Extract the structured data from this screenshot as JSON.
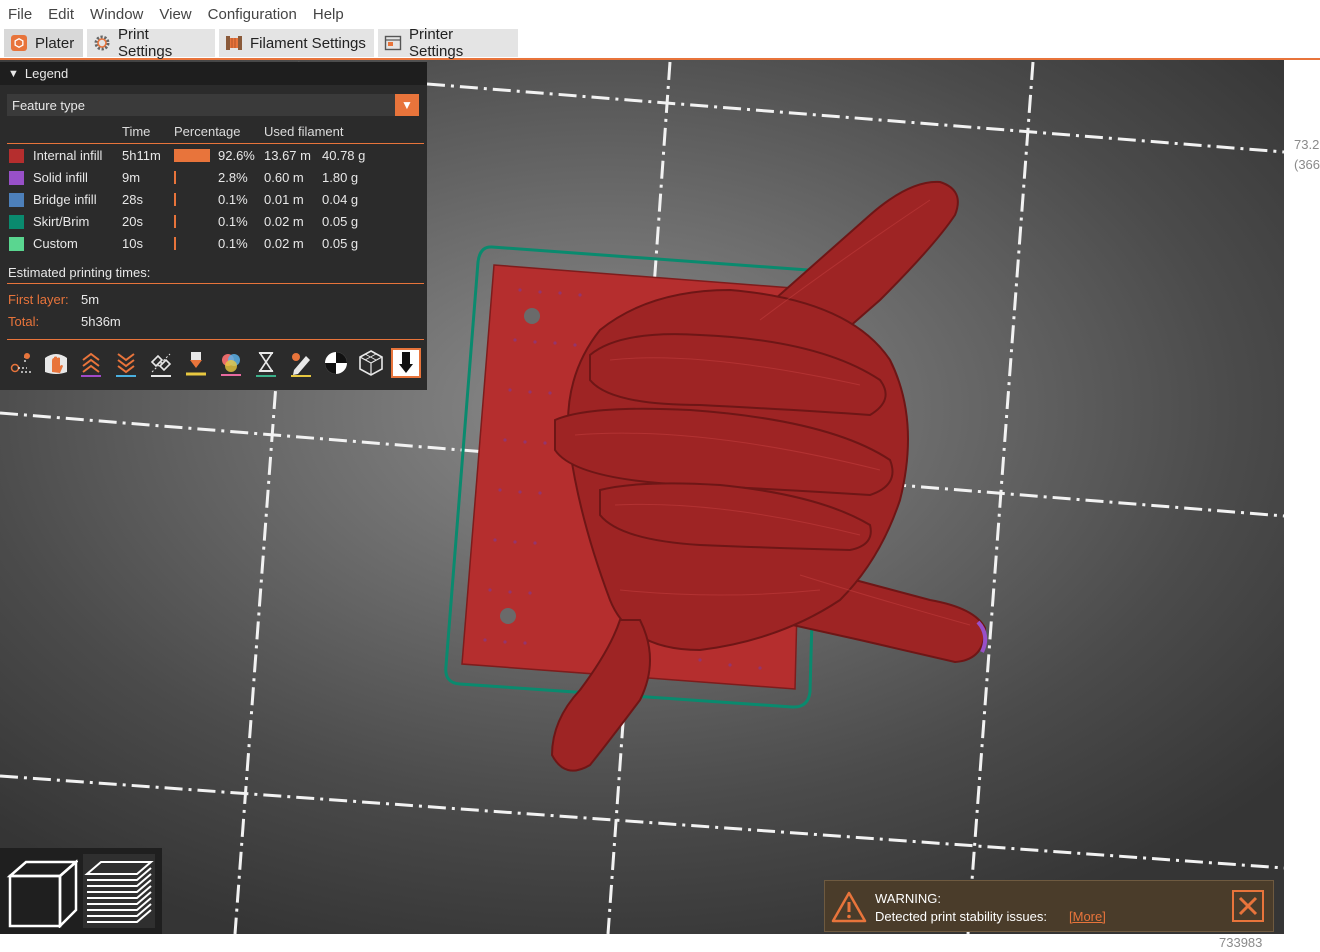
{
  "menu": [
    "File",
    "Edit",
    "Window",
    "View",
    "Configuration",
    "Help"
  ],
  "tabs": [
    {
      "label": "Plater",
      "icon": "plater-icon",
      "active": true
    },
    {
      "label": "Print Settings",
      "icon": "gear-icon"
    },
    {
      "label": "Filament Settings",
      "icon": "filament-spool-icon"
    },
    {
      "label": "Printer Settings",
      "icon": "printer-icon"
    }
  ],
  "legend": {
    "title": "Legend",
    "view_type": "Feature type",
    "columns": {
      "time": "Time",
      "percentage": "Percentage",
      "used_filament": "Used filament"
    },
    "rows": [
      {
        "name": "Internal infill",
        "color": "#b52e2e",
        "time": "5h11m",
        "percent_value": 92.6,
        "percent": "92.6%",
        "length": "13.67 m",
        "weight": "40.78 g"
      },
      {
        "name": "Solid infill",
        "color": "#9850c8",
        "time": "9m",
        "percent_value": 2.8,
        "percent": "2.8%",
        "length": "0.60 m",
        "weight": "1.80 g"
      },
      {
        "name": "Bridge infill",
        "color": "#4d80ba",
        "time": "28s",
        "percent_value": 0.1,
        "percent": "0.1%",
        "length": "0.01 m",
        "weight": "0.04 g"
      },
      {
        "name": "Skirt/Brim",
        "color": "#0a8a6e",
        "time": "20s",
        "percent_value": 0.1,
        "percent": "0.1%",
        "length": "0.02 m",
        "weight": "0.05 g"
      },
      {
        "name": "Custom",
        "color": "#5ad690",
        "time": "10s",
        "percent_value": 0.1,
        "percent": "0.1%",
        "length": "0.02 m",
        "weight": "0.05 g"
      }
    ],
    "estimated_label": "Estimated printing times:",
    "first_layer_label": "First layer:",
    "first_layer_value": "5m",
    "total_label": "Total:",
    "total_value": "5h36m",
    "toolbar_icons": [
      "travel-icon",
      "wipe-hand-icon",
      "retractions-icon",
      "deretractions-icon",
      "seams-icon",
      "tool-changes-icon",
      "color-changes-icon",
      "pause-icon",
      "custom-gcode-icon",
      "center-of-gravity-icon",
      "shells-icon",
      "tool-marker-icon"
    ]
  },
  "viewport": {
    "coord_line1": "73.2",
    "coord_line2": "(366",
    "footer_number": "733983"
  },
  "view_buttons": [
    "3d-view-icon",
    "preview-layers-icon"
  ],
  "warning": {
    "title": "WARNING:",
    "message": "Detected print stability issues:",
    "link": "[More]"
  }
}
